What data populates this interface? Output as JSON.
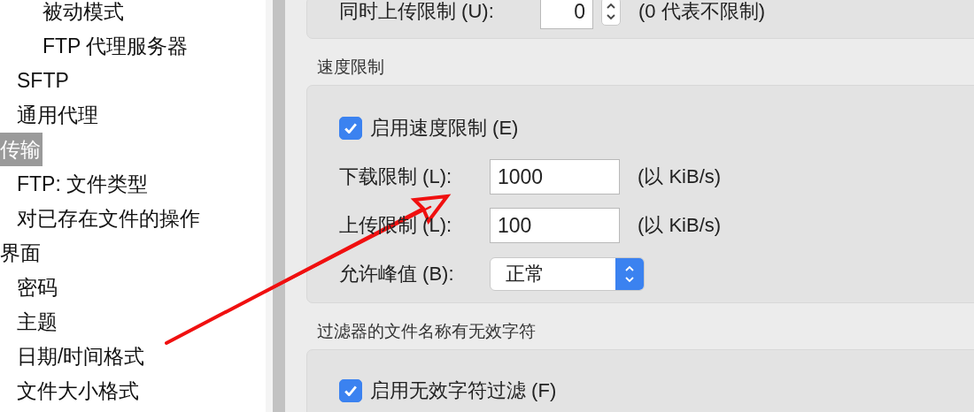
{
  "sidebar": {
    "items": [
      {
        "children": [
          {
            "children": [
              {
                "label": "被动模式",
                "selected": false
              },
              {
                "label": "FTP 代理服务器",
                "selected": false
              }
            ]
          },
          {
            "label": "SFTP",
            "selected": false
          },
          {
            "label": "通用代理",
            "selected": false
          }
        ]
      },
      {
        "label": "传输",
        "selected": true,
        "children": [
          {
            "label": "FTP: 文件类型",
            "selected": false
          },
          {
            "label": "对已存在文件的操作",
            "selected": false
          }
        ]
      },
      {
        "label": "界面",
        "selected": false,
        "children": [
          {
            "label": "密码",
            "selected": false
          },
          {
            "label": "主题",
            "selected": false
          },
          {
            "label": "日期/时间格式",
            "selected": false
          },
          {
            "label": "文件大小格式",
            "selected": false
          }
        ]
      }
    ]
  },
  "groups": [
    {
      "rows": [
        {
          "kind": "spin",
          "label": "同时上传限制 (U):",
          "value": "0",
          "note": "(0 代表不限制)"
        }
      ]
    },
    {
      "title": "速度限制",
      "rows": [
        {
          "kind": "checkbox",
          "label": "启用速度限制 (E)",
          "checked": true
        },
        {
          "kind": "text",
          "label": "下载限制 (L):",
          "value": "1000",
          "note": "(以 KiB/s)"
        },
        {
          "kind": "text",
          "label": "上传限制 (L):",
          "value": "100",
          "note": "(以 KiB/s)"
        },
        {
          "kind": "select",
          "label": "允许峰值 (B):",
          "value": "正常"
        }
      ]
    },
    {
      "title": "过滤器的文件名称有无效字符",
      "rows": [
        {
          "kind": "checkbox",
          "label": "启用无效字符过滤 (F)",
          "checked": true
        }
      ]
    }
  ]
}
